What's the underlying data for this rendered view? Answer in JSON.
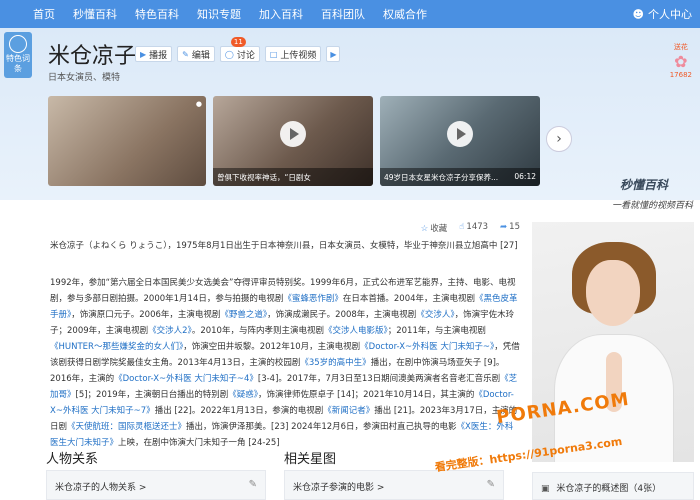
{
  "nav": {
    "items": [
      "首页",
      "秒懂百科",
      "特色百科",
      "知识专题",
      "加入百科",
      "百科团队",
      "权威合作"
    ],
    "user": "个人中心"
  },
  "badge": {
    "text": "特色词条"
  },
  "header": {
    "title": "米仓凉子",
    "subtitle": "日本女演员、模特",
    "actions": {
      "play": "播报",
      "edit": "编辑",
      "discuss": "讨论",
      "discuss_count": "11",
      "upload": "上传视频"
    },
    "like_text": "送花",
    "like_count": "17682"
  },
  "videos": [
    {
      "caption": "",
      "duration": ""
    },
    {
      "caption": "曾俱下收视率神话，“日剧女",
      "duration": ""
    },
    {
      "caption": "49岁日本女星米仓凉子分享保养...",
      "duration": "06:12"
    }
  ],
  "brand": {
    "name": "秒懂百科",
    "slogan": "一看就懂的视频百科"
  },
  "stats": {
    "collect": "收藏",
    "likes": "1473",
    "shares": "15"
  },
  "intro": {
    "p1": "米仓凉子（よねくら りょうこ），1975年8月1日出生于日本神奈川县，日本女演员、女模特，毕业于神奈川县立旭高中 [27]",
    "p2a": "1992年，参加“第六届全日本国民美少女选美会”夺得评审员特别奖。1999年6月，正式公布进军艺能界，主持、电影、电视剧，参与多部日剧拍摄。2000年1月14日，参与拍摄的电视剧",
    "p2b": "《蜜蜂恶作剧》",
    "p2c": "在日本首播。2004年，主演电视剧",
    "p2d": "《黑色皮革手册》",
    "p2e": "，饰演原口元子。2006年，主演电视剧",
    "p2f": "《野兽之道》",
    "p2g": "，饰演成濑民子。2008年，主演电视剧",
    "p2h": "《交涉人》",
    "p2i": "，饰演宇佐木玲子；2009年，主演电视剧",
    "p2j": "《交涉人2》",
    "p2k": "。2010年，与阵内孝则主演电视剧",
    "p2l": "《交涉人电影版》",
    "p2m": "；2011年，与主演电视剧",
    "p2n": "《HUNTER～那些嫌奖金的女人们》",
    "p2o": "，饰演空田井坂黎。2012年10月，主演电视剧",
    "p2p": "《Doctor-X~外科医 大门未知子~》",
    "p2q": "，凭借该剧获得日剧学院奖最佳女主角。2013年4月13日，主演的校园剧",
    "p2r": "《35岁的高中生》",
    "p2s": "播出，在剧中饰演马场亚矢子 [9]。2016年，主演的",
    "p2t": "《Doctor-X~外科医 大门未知子~4》",
    "p2u": "[3-4]。2017年，7月3日至13日期间澳美两演者名音老汇音乐剧",
    "p2v": "《芝加哥》",
    "p2w": "[5]；2019年，主演朝日台播出的特别剧",
    "p2x": "《疑惑》",
    "p2y": "，饰演律师佐原卓子 [14]；2021年10月14日，其主演的",
    "p2z": "《Doctor-X~外科医 大门未知子~7》",
    "p2aa": "播出 [22]。2022年1月13日，参演的电视剧",
    "p2ab": "《新闻记者》",
    "p2ac": "播出 [21]。2023年3月17日，主演的日剧",
    "p2ad": "《天使航班：国际灵柩送还士》",
    "p2ae": "播出，饰演伊泽那美。[23] 2024年12月6日，参演田村直己执导的电影",
    "p2af": "《X医生：外科医生大门未知子》",
    "p2ag": "上映，在剧中饰演大门未知子一角 [24-25]"
  },
  "sections": {
    "relations_title": "人物关系",
    "relations_box": "米仓凉子的人物关系 >",
    "films_title": "相关星图",
    "films_box": "米仓凉子参演的电影 >"
  },
  "photo": {
    "caption": "米仓凉子的概述图（4张）"
  },
  "watermark": {
    "line1": "PORNA.COM",
    "line2": "看完整版：https://91porna3.com"
  }
}
